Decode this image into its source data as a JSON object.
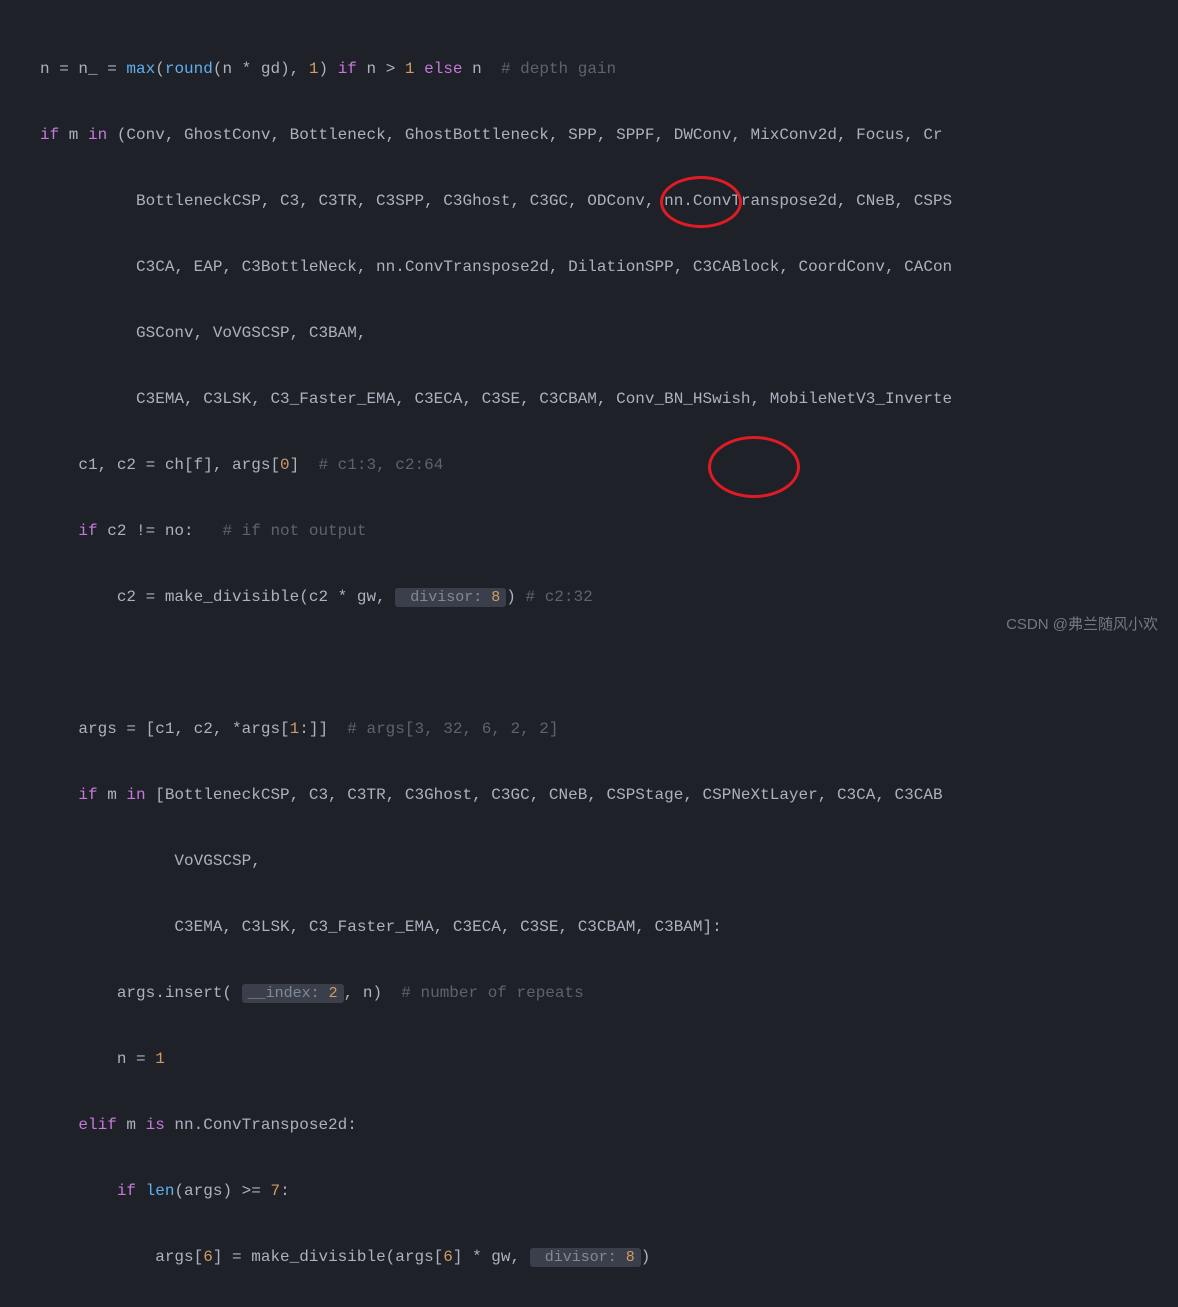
{
  "code": {
    "l1_a": "n = n_ = ",
    "l1_b": "(",
    "l1_c": "(n * gd), ",
    "l1_d": ") ",
    "l1_e": " n > ",
    "l1_f": " n  ",
    "l1_comment": "# depth gain",
    "l2_a": " m ",
    "l2_b": " (Conv, GhostConv, Bottleneck, GhostBottleneck, SPP, SPPF, DWConv, MixConv2d, Focus, Cr",
    "l3": "          BottleneckCSP, C3, C3TR, C3SPP, C3Ghost, C3GC, ODConv, nn.ConvTranspose2d, CNeB, CSPS",
    "l4": "          C3CA, EAP, C3BottleNeck, nn.ConvTranspose2d, DilationSPP, C3CABlock, CoordConv, CACon",
    "l5": "          GSConv, VoVGSCSP, C3BAM,",
    "l6": "          C3EMA, C3LSK, C3_Faster_EMA, C3ECA, C3SE, C3CBAM, Conv_BN_HSwish, MobileNetV3_Inverte",
    "l7_a": "    c1, c2 = ch[f], args[",
    "l7_b": "]  ",
    "l7_comment": "# c1:3, c2:64",
    "l8_a": "    ",
    "l8_b": " c2 != no:   ",
    "l8_comment": "# if not output",
    "l9_a": "        c2 = make_divisible(c2 * gw, ",
    "l9_hint": " divisor: ",
    "l9_b": ") ",
    "l9_comment": "# c2:32",
    "l11_a": "    args = [c1, c2, *args[",
    "l11_b": ":]]  ",
    "l11_comment": "# args[3, 32, 6, 2, 2]",
    "l12_a": "    ",
    "l12_b": " m ",
    "l12_c": " [BottleneckCSP, C3, C3TR, C3Ghost, C3GC, CNeB, CSPStage, CSPNeXtLayer, C3CA, C3CAB",
    "l13": "              VoVGSCSP,",
    "l14": "              C3EMA, C3LSK, C3_Faster_EMA, C3ECA, C3SE, C3CBAM, C3BAM]:",
    "l15_a": "        args.insert( ",
    "l15_hint": "__index: ",
    "l15_b": ", n)  ",
    "l15_comment": "# number of repeats",
    "l16_a": "        n = ",
    "l17_a": "    ",
    "l17_b": " m ",
    "l17_c": " nn.ConvTranspose2d:",
    "l18_a": "        ",
    "l18_b": " ",
    "l18_c": "(args) >= ",
    "l18_d": ":",
    "l19_a": "            args[",
    "l19_b": "] = make_divisible(args[",
    "l19_c": "] * gw, ",
    "l19_hint": " divisor: ",
    "l19_d": ")",
    "kw_if": "if",
    "kw_in": "in",
    "kw_else": "else",
    "kw_elif": "elif",
    "kw_is": "is",
    "fn_max": "max",
    "fn_round": "round",
    "fn_len": "len",
    "num_0": "0",
    "num_1": "1",
    "num_2": "2",
    "num_6": "6",
    "num_7": "7",
    "num_8": "8"
  },
  "watermark": "CSDN @弗兰随风小欢"
}
